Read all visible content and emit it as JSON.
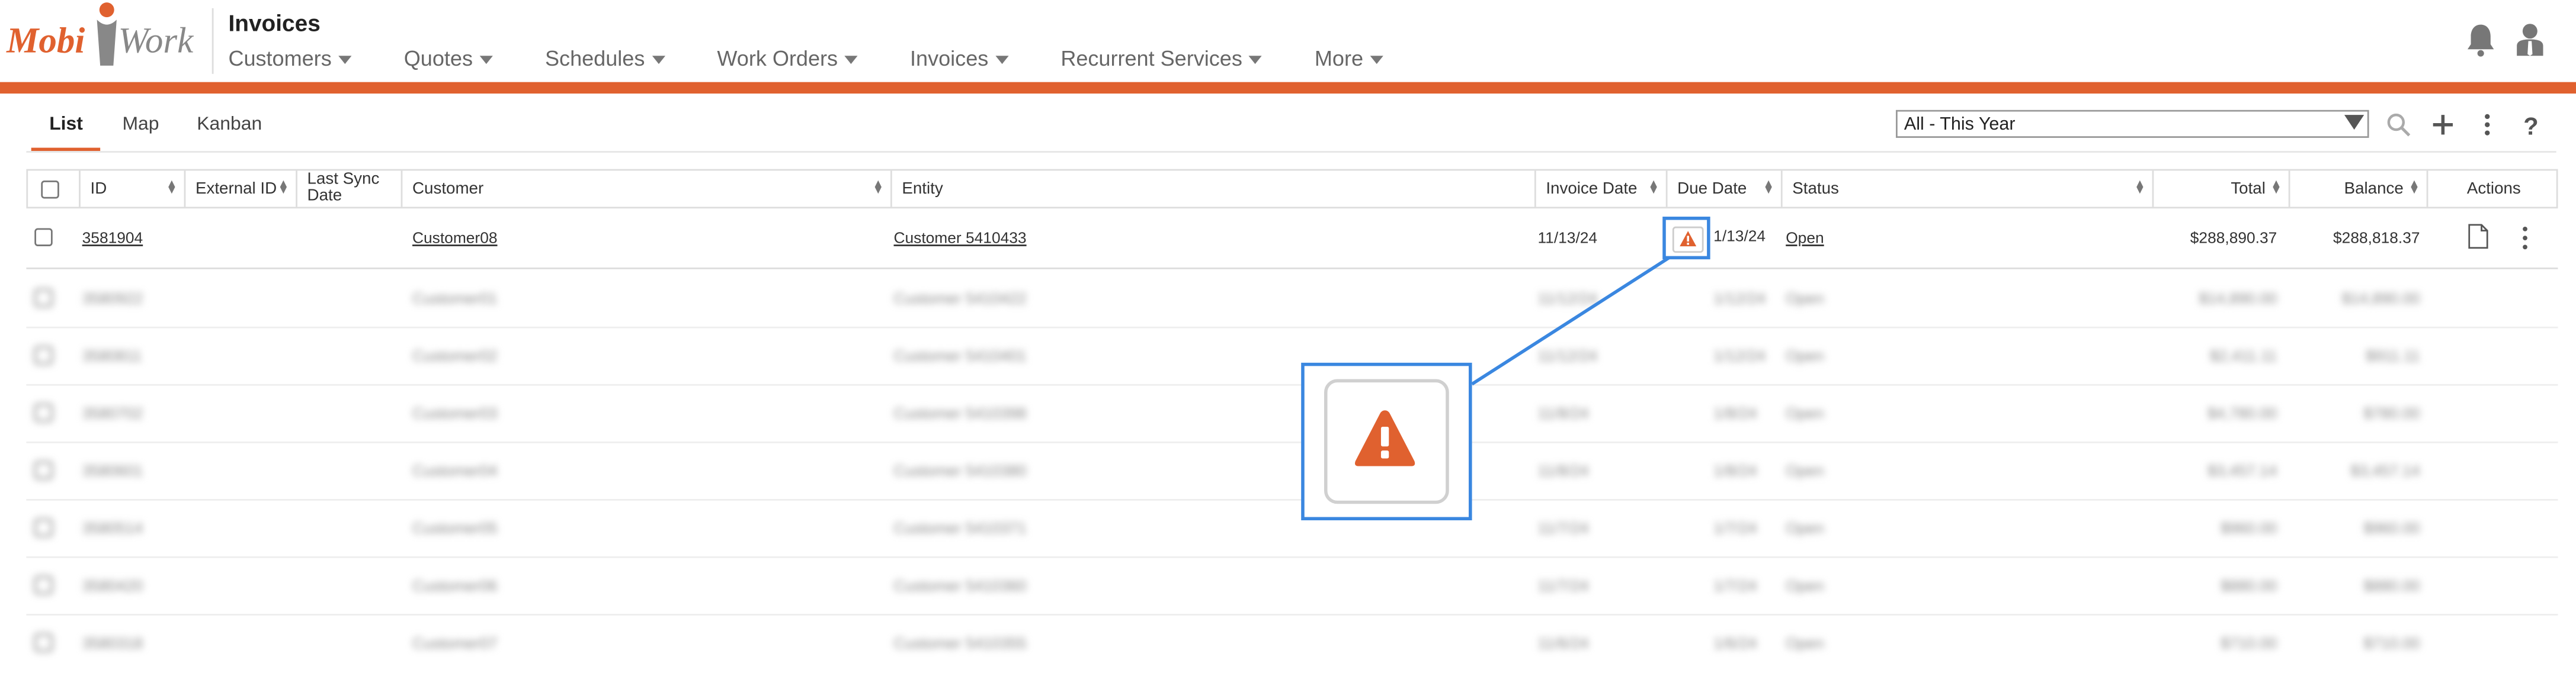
{
  "app": {
    "logo_text_mobi": "Mobi",
    "logo_text_work": "Work",
    "title": "Invoices"
  },
  "nav": {
    "items": [
      {
        "label": "Customers"
      },
      {
        "label": "Quotes"
      },
      {
        "label": "Schedules"
      },
      {
        "label": "Work Orders"
      },
      {
        "label": "Invoices"
      },
      {
        "label": "Recurrent Services"
      },
      {
        "label": "More"
      }
    ]
  },
  "tabs": {
    "list": "List",
    "map": "Map",
    "kanban": "Kanban"
  },
  "filter": {
    "selected": "All - This Year"
  },
  "columns": {
    "id": "ID",
    "external_id": "External ID",
    "last_sync_1": "Last Sync",
    "last_sync_2": "Date",
    "customer": "Customer",
    "entity": "Entity",
    "invoice_date": "Invoice Date",
    "due_date": "Due Date",
    "status": "Status",
    "total": "Total",
    "balance": "Balance",
    "actions": "Actions"
  },
  "first_row": {
    "id": "3581904",
    "customer": "Customer08",
    "entity": "Customer 5410433",
    "invoice_date": "11/13/24",
    "due_date": "1/13/24",
    "status": "Open",
    "total": "$288,890.37",
    "balance": "$288,818.37"
  },
  "blurred_rows": [
    {
      "id": "3580922",
      "customer": "Customer01",
      "entity": "Customer 5410422",
      "invoice_date": "11/12/24",
      "due_date": "1/12/24",
      "status": "Open",
      "total": "$14,890.00",
      "balance": "$14,890.00"
    },
    {
      "id": "3580811",
      "customer": "Customer02",
      "entity": "Customer 5410401",
      "invoice_date": "11/12/24",
      "due_date": "1/12/24",
      "status": "Open",
      "total": "$2,411.11",
      "balance": "$911.11"
    },
    {
      "id": "3580702",
      "customer": "Customer03",
      "entity": "Customer 5410398",
      "invoice_date": "11/8/24",
      "due_date": "1/8/24",
      "status": "Open",
      "total": "$4,780.00",
      "balance": "$780.00"
    },
    {
      "id": "3580601",
      "customer": "Customer04",
      "entity": "Customer 5410380",
      "invoice_date": "11/8/24",
      "due_date": "1/8/24",
      "status": "Open",
      "total": "$3,457.14",
      "balance": "$3,457.14"
    },
    {
      "id": "3580514",
      "customer": "Customer05",
      "entity": "Customer 5410371",
      "invoice_date": "11/7/24",
      "due_date": "1/7/24",
      "status": "Open",
      "total": "$960.00",
      "balance": "$960.00"
    },
    {
      "id": "3580420",
      "customer": "Customer06",
      "entity": "Customer 5410360",
      "invoice_date": "11/7/24",
      "due_date": "1/7/24",
      "status": "Open",
      "total": "$880.00",
      "balance": "$880.00"
    },
    {
      "id": "3580318",
      "customer": "Customer07",
      "entity": "Customer 5410355",
      "invoice_date": "11/6/24",
      "due_date": "1/6/24",
      "status": "Open",
      "total": "$710.00",
      "balance": "$710.00"
    }
  ],
  "colors": {
    "accent": "#e0612f",
    "highlight": "#3a87e0",
    "warning": "#e0612f"
  },
  "icons": [
    "bell-icon",
    "user-icon",
    "search-icon",
    "plus-icon",
    "more-vertical-icon",
    "help-icon",
    "warning-icon",
    "document-icon"
  ]
}
